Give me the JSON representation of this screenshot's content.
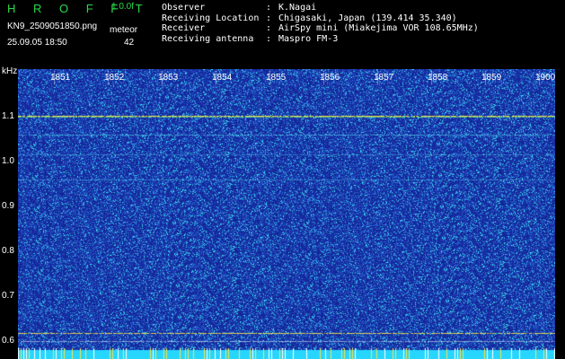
{
  "header": {
    "title": "H R O F F T",
    "version": "1.0.0f",
    "filename": "KN9_2509051850.png",
    "datetime": "25.09.05 18:50",
    "meteor_label": "meteor",
    "meteor_count": "42"
  },
  "info": {
    "rows": [
      {
        "label": "Observer",
        "sep": ":",
        "value": "K.Nagai"
      },
      {
        "label": "Receiving Location",
        "sep": ":",
        "value": "Chigasaki, Japan (139.414 35.340)"
      },
      {
        "label": "Receiver",
        "sep": ":",
        "value": "AirSpy mini (Miakejima VOR 108.65MHz)"
      },
      {
        "label": "Receiving antenna",
        "sep": ":",
        "value": "Maspro FM-3"
      }
    ]
  },
  "plot": {
    "y_unit": "kHz",
    "y_labels": [
      "1.1",
      "1.0",
      "0.9",
      "0.8",
      "0.7",
      "0.6"
    ],
    "x_labels": [
      "1851",
      "1852",
      "1853",
      "1854",
      "1855",
      "1856",
      "1857",
      "1858",
      "1859",
      "1900"
    ],
    "colors": {
      "background": "#1a2a9e",
      "noise_high": "#35e6f0",
      "noise_mid": "#2f7fe0",
      "signal": "#f2e24a",
      "baseline": "#27d6ff"
    }
  }
}
